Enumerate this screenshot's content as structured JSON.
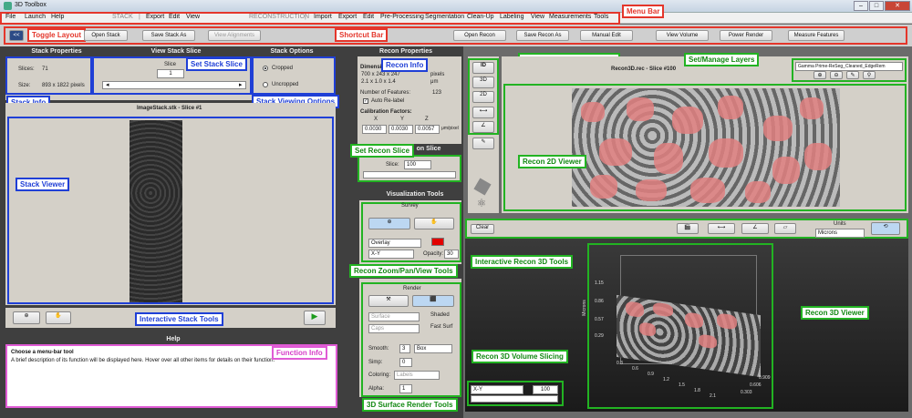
{
  "window": {
    "title": "3D Toolbox"
  },
  "menu": {
    "left": [
      "File",
      "Launch",
      "Help"
    ],
    "stack_header": "STACK",
    "stack_items": [
      "Export",
      "Edit",
      "View"
    ],
    "recon_header": "RECONSTRUCTION",
    "recon_items": [
      "Import",
      "Export",
      "Edit",
      "Pre-Processing",
      "Segmentation",
      "Clean-Up",
      "Labeling",
      "View",
      "Measurements",
      "Tools"
    ]
  },
  "shortcut": {
    "toggle": "<<",
    "open_stack": "Open Stack",
    "save_stack_as": "Save Stack As",
    "view_alignments": "View Alignments",
    "open_recon": "Open Recon",
    "save_recon_as": "Save Recon As",
    "manual_edit": "Manual Edit",
    "view_volume": "View Volume",
    "power_render": "Power Render",
    "measure_features": "Measure Features"
  },
  "stack": {
    "properties_title": "Stack Properties",
    "slices_label": "Slices:",
    "slices_value": "71",
    "size_label": "Size:",
    "size_value": "893 x 1822 pixels",
    "view_slice_title": "View Stack Slice",
    "slice_label": "Slice",
    "slice_value": "1",
    "options_title": "Stack Options",
    "cropped": "Cropped",
    "uncropped": "Uncropped",
    "viewer_title": "ImageStack.stk - Slice #1"
  },
  "help": {
    "title": "Help",
    "heading": "Choose a menu-bar tool",
    "text": "A brief description of its function will be displayed here. Hover over all other items for details on their function."
  },
  "recon": {
    "properties_title": "Recon Properties",
    "dimensions_label": "Dimensions:",
    "dim_row1": "700  x  243  x  247",
    "dim_unit1": "pixels",
    "dim_row2": "2.1  x  1.0  x  1.4",
    "dim_unit2": "μm",
    "features_label": "Number of Features:",
    "features_value": "123",
    "auto_relabel": "Auto Re-label",
    "calibration_label": "Calibration Factors:",
    "cal_x": "X",
    "cal_y": "Y",
    "cal_z": "Z",
    "cal_xv": "0.0030",
    "cal_yv": "0.0030",
    "cal_zv": "0.0057",
    "cal_unit": "μm/pixel",
    "slice_title": "on Slice",
    "slice_label": "Slice:",
    "slice_value": "100",
    "vis_title": "Visualization Tools",
    "survey": "Survey",
    "overlay": "Overlay",
    "axis": "X-Y",
    "opacity_label": "Opacity:",
    "opacity_value": "30",
    "render": "Render",
    "surface": "Surface",
    "caps": "Caps",
    "smooth_label": "Smooth:",
    "smooth_value": "3",
    "smooth_kind": "Box",
    "simp_label": "Simp:",
    "simp_value": "0",
    "coloring_label": "Coloring:",
    "coloring_value": "Labels",
    "alpha_label": "Alpha:",
    "alpha_value": "1",
    "shaded": "Shaded",
    "fast_surf": "Fast Surf",
    "viewer2d_title": "Recon3D.rec - Slice #100",
    "layer": "Gamma Prime-ReSeg_Cleaned_EdgeRem",
    "clear": "Clear",
    "units_label": "Units",
    "units_value": "Microns",
    "vol_axis": "X-Y",
    "vol_value": "100",
    "tool_2d": "2D",
    "tool_3d": "3D",
    "tool_id": "ID",
    "ticks_z": [
      "1.15",
      "0.86",
      "0.57",
      "0.29"
    ],
    "ticks_x": [
      "0.3",
      "0.6",
      "0.9",
      "1.2",
      "1.5",
      "1.8",
      "2.1"
    ],
    "ticks_y": [
      "0.303",
      "0.606",
      "0.909"
    ],
    "z_axis": "Microns"
  },
  "annotations": {
    "menu_bar": "Menu Bar",
    "toggle_layout": "Toggle Layout",
    "shortcut_bar": "Shortcut Bar",
    "set_stack_slice": "Set Stack Slice",
    "stack_info": "Stack Info",
    "stack_viewing": "Stack Viewing Options",
    "stack_viewer": "Stack Viewer",
    "interactive_stack": "Interactive Stack Tools",
    "function_info": "Function Info",
    "recon_info": "Recon Info",
    "interactive_2d": "Interactive Recon 2D Tools",
    "set_layers": "Set/Manage Layers",
    "set_recon_slice": "Set Recon Slice",
    "recon_2d_viewer": "Recon 2D Viewer",
    "zoom_tools": "Recon Zoom/Pan/View Tools",
    "interactive_3d": "Interactive Recon 3D Tools",
    "recon_3d_viewer": "Recon 3D Viewer",
    "vol_slicing": "Recon 3D Volume Slicing",
    "surface_tools": "3D Surface Render Tools"
  },
  "colors": {
    "red": "#e4362b",
    "blue": "#1f3fd6",
    "green": "#22b322",
    "pink": "#e05bd5"
  }
}
